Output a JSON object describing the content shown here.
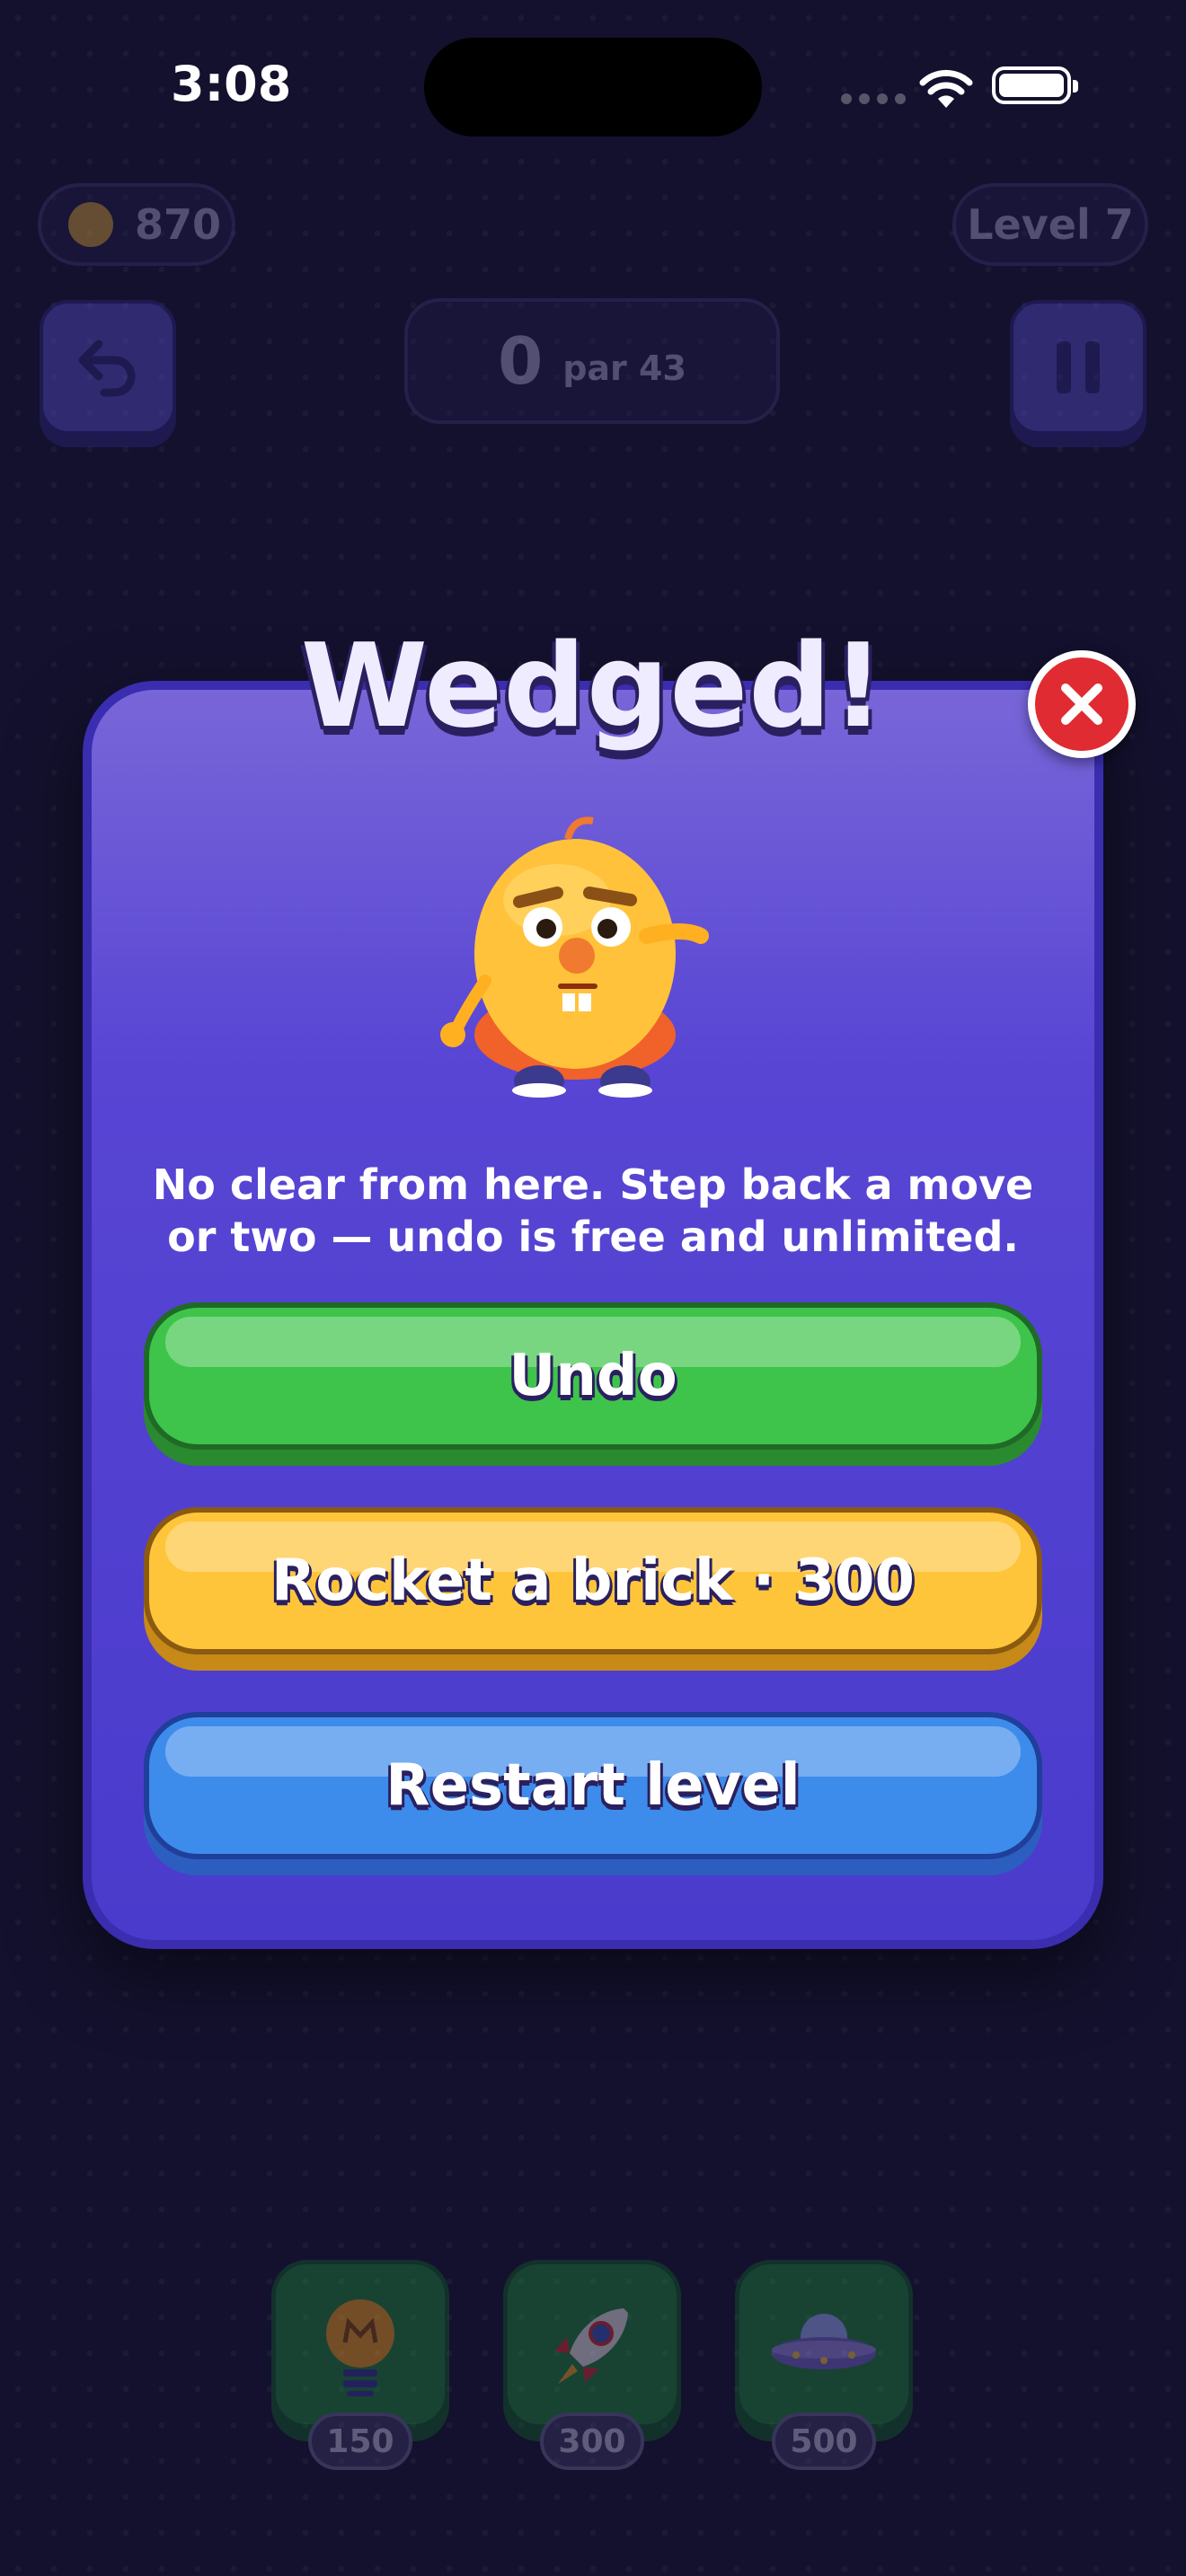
{
  "status_bar": {
    "time": "3:08"
  },
  "hud": {
    "coins": "870",
    "level": "Level 7",
    "moves": "0",
    "par": "par 43"
  },
  "modal": {
    "title": "Wedged!",
    "message": "No clear from here. Step back a move or two — undo is free and unlimited.",
    "buttons": {
      "undo": "Undo",
      "rocket": "Rocket a brick · 300",
      "restart": "Restart level"
    }
  },
  "boosters": [
    {
      "icon": "lightbulb-icon",
      "price": "150"
    },
    {
      "icon": "rocket-icon",
      "price": "300"
    },
    {
      "icon": "ufo-icon",
      "price": "500"
    }
  ],
  "colors": {
    "background": "#14112e",
    "modal": "#5845d4",
    "undo_green": "#3ec44a",
    "rocket_yellow": "#ffc53a",
    "restart_blue": "#3d8cec",
    "close_red": "#e02b32"
  }
}
